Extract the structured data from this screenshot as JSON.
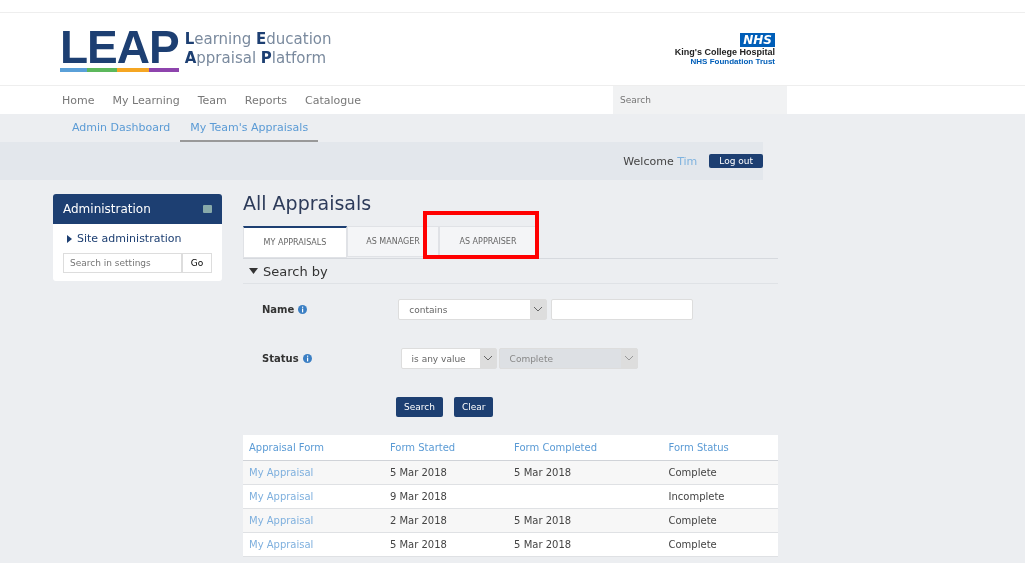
{
  "logo": {
    "letters": [
      {
        "text": "L",
        "color": "#5aa0d8"
      },
      {
        "text": "E",
        "color": "#5cb85c"
      },
      {
        "text": "A",
        "color": "#f5a623"
      },
      {
        "text": "P",
        "color": "#8e44ad"
      }
    ],
    "tagline": [
      "**L**earning **E**ducation",
      "**A**ppraisal **P**latform"
    ]
  },
  "trust": {
    "badge": "NHS",
    "name": "King's College Hospital",
    "subtitle": "NHS Foundation Trust"
  },
  "nav": {
    "items": [
      "Home",
      "My Learning",
      "Team",
      "Reports",
      "Catalogue"
    ],
    "search": {
      "placeholder": "Search"
    }
  },
  "subnav": [
    {
      "label": "Admin Dashboard",
      "selected": false
    },
    {
      "label": "My Team's Appraisals",
      "selected": true
    }
  ],
  "user": {
    "greeting": "Welcome",
    "name": "Tim",
    "logout": "Log out"
  },
  "sidebar": {
    "title": "Administration",
    "items": [
      "Site administration"
    ],
    "search": {
      "placeholder": "Search in settings",
      "button": "Go"
    }
  },
  "page_title": "All Appraisals",
  "tabs": [
    {
      "label": "MY APPRAISALS",
      "selected": true,
      "highlighted": false
    },
    {
      "label": "AS MANAGER",
      "selected": false,
      "highlighted": false
    },
    {
      "label": "AS APPRAISER",
      "selected": false,
      "highlighted": true
    }
  ],
  "search_by": {
    "title": "Search by",
    "expanded": true,
    "filters": [
      {
        "label": "Name",
        "operator": "contains",
        "disabled": false
      },
      {
        "label": "Status",
        "operator": "is any value",
        "value": "Complete",
        "disabled": true
      }
    ],
    "buttons": [
      "Search",
      "Clear"
    ]
  },
  "table": {
    "columns": [
      "Appraisal Form",
      "Form Started",
      "Form Completed",
      "Form Status"
    ],
    "rows": [
      [
        "My Appraisal",
        "5 Mar 2018",
        "5 Mar 2018",
        "Complete"
      ],
      [
        "My Appraisal",
        "9 Mar 2018",
        "",
        "Incomplete"
      ],
      [
        "My Appraisal",
        "2 Mar 2018",
        "5 Mar 2018",
        "Complete"
      ],
      [
        "My Appraisal",
        "5 Mar 2018",
        "5 Mar 2018",
        "Complete"
      ]
    ]
  }
}
